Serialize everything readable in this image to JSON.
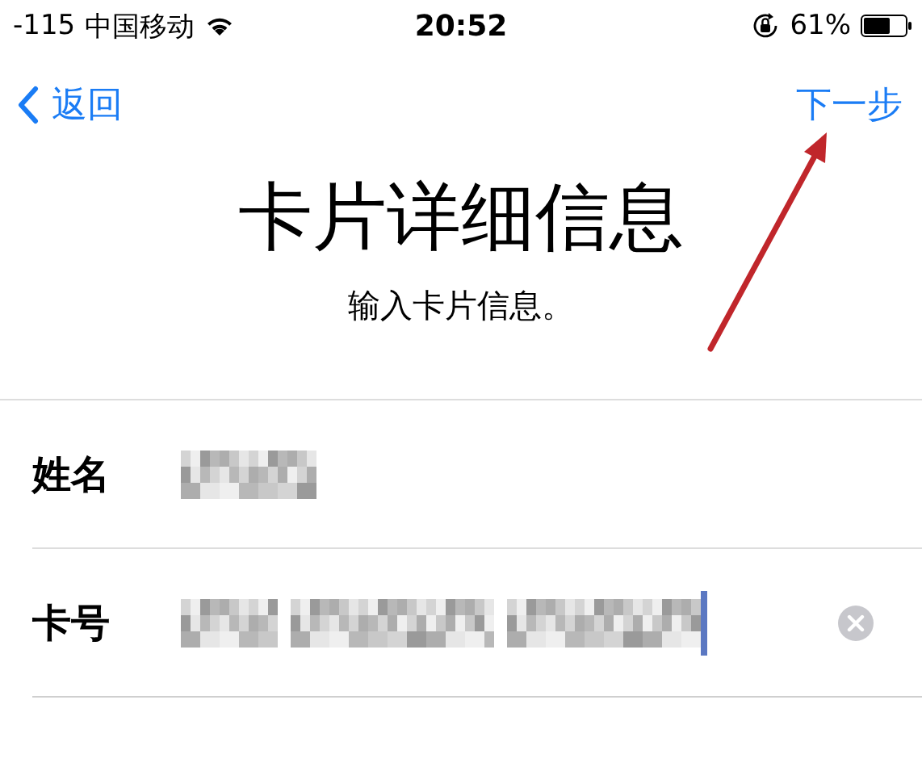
{
  "status_bar": {
    "signal": "-115",
    "carrier": "中国移动",
    "time": "20:52",
    "battery": "61%"
  },
  "nav": {
    "back": "返回",
    "next": "下一步"
  },
  "title": "卡片详细信息",
  "subtitle": "输入卡片信息。",
  "fields": [
    {
      "label": "姓名",
      "focused": false
    },
    {
      "label": "卡号",
      "focused": true
    }
  ]
}
